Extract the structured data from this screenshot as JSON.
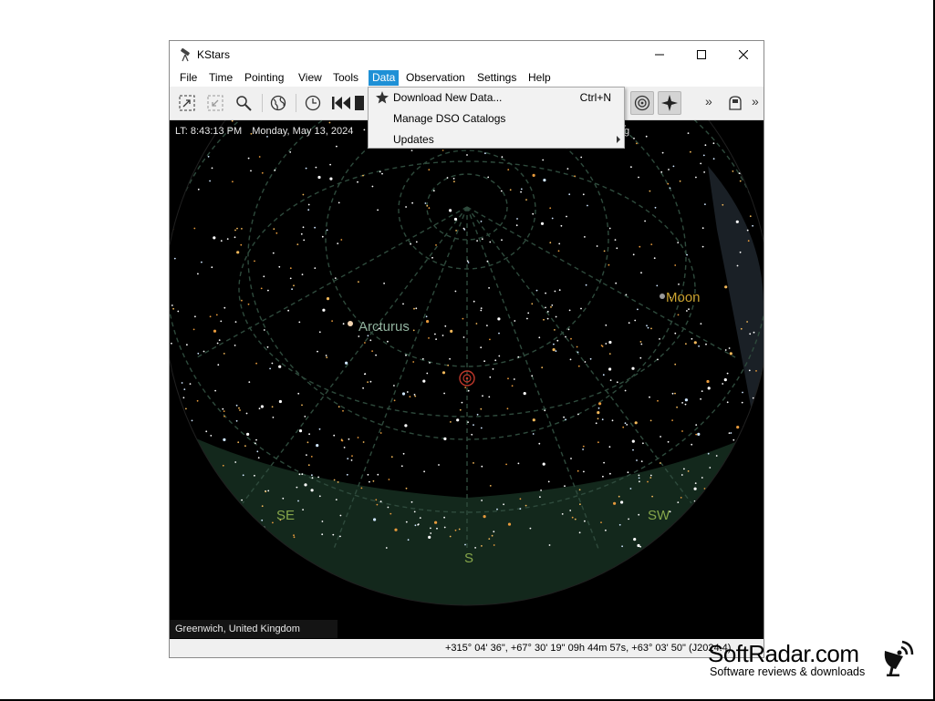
{
  "window": {
    "title": "KStars",
    "controls": {
      "minimize": "minimize-icon",
      "maximize": "maximize-icon",
      "close": "close-icon"
    }
  },
  "menubar": {
    "items": [
      {
        "label": "File"
      },
      {
        "label": "Time"
      },
      {
        "label": "Pointing"
      },
      {
        "label": "View"
      },
      {
        "label": "Tools"
      },
      {
        "label": "Data",
        "active": true
      },
      {
        "label": "Observation"
      },
      {
        "label": "Settings"
      },
      {
        "label": "Help"
      }
    ]
  },
  "toolbar": {
    "icons": [
      "zoom-to-selection-icon",
      "zoom-fit-icon",
      "search-icon",
      "globe-icon",
      "clock-icon",
      "skip-backward-icon",
      "stop-icon",
      "target-icon",
      "star-icon",
      "more-icon",
      "export-icon",
      "more-icon"
    ],
    "overflow_glyph": "»"
  },
  "data_menu": {
    "items": [
      {
        "label": "Download New Data...",
        "shortcut": "Ctrl+N",
        "icon": "star-icon"
      },
      {
        "label": "Manage DSO Catalogs"
      },
      {
        "label": "Updates",
        "has_submenu": true
      }
    ]
  },
  "skymap": {
    "local_time": "LT: 8:43:13 PM",
    "date": "Monday, May 13, 2024",
    "top_right_fragment": "g",
    "location": "Greenwich, United Kingdom",
    "labels": {
      "arcturus": "Arcturus",
      "moon": "Moon",
      "southeast": "SE",
      "south": "S",
      "southwest": "SW"
    },
    "colors": {
      "sky": "#000000",
      "ground": "#13281c",
      "grid": "#2e4a3c",
      "label": "#8fb09c",
      "moon": "#c9a12e",
      "compass": "#86a64a"
    }
  },
  "statusbar": {
    "coordinates": "+315° 04' 36\", +67° 30' 19\"  09h 44m 57s, +63° 03' 50\" (J2024.4)"
  },
  "watermark": {
    "title": "SoftRadar.com",
    "subtitle": "Software reviews & downloads"
  }
}
